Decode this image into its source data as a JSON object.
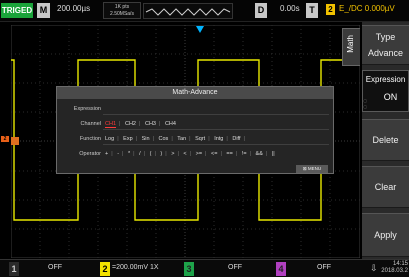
{
  "topbar": {
    "trigger_status": "TRIGED",
    "acq_mode": "M",
    "timebase": "200.00µs",
    "points_line1": "1K pts",
    "points_line2": "2.50MSa/s",
    "delay_label": "D",
    "delay_value": "0.00s",
    "trigger_label": "T",
    "trigger_channel": "2",
    "trigger_info": "E_/DC 0.000µV"
  },
  "menu": {
    "side_tab": "Math",
    "items": [
      {
        "title": "Type",
        "value": "Advance"
      },
      {
        "title": "Expression",
        "value": "ON"
      },
      {
        "title": "Delete",
        "value": ""
      },
      {
        "title": "Clear",
        "value": ""
      },
      {
        "title": "Apply",
        "value": ""
      }
    ]
  },
  "dialog": {
    "title": "Math-Advance",
    "expression_label": "Expression",
    "channel_label": "Channel",
    "channels": [
      "CH1",
      "CH2",
      "CH3",
      "CH4"
    ],
    "function_label": "Function",
    "functions": [
      "Log",
      "Exp",
      "Sin",
      "Cos",
      "Tan",
      "Sqrt",
      "Intg",
      "Diff"
    ],
    "operator_label": "Operator",
    "operators": [
      "+",
      "-",
      "*",
      "/",
      "(",
      ")",
      ">",
      "<",
      ">=",
      "<=",
      "==",
      "!=",
      "&&",
      "||"
    ],
    "menu_button": "MENU"
  },
  "bottombar": {
    "channels": [
      {
        "num": "1",
        "value": "OFF",
        "color": "#f2e100"
      },
      {
        "num": "2",
        "value": "=200.00mV 1X",
        "color": "#f2e100"
      },
      {
        "num": "3",
        "value": "OFF",
        "color": "#1ea34a"
      },
      {
        "num": "4",
        "value": "OFF",
        "color": "#b040c0"
      }
    ],
    "time": "14:15",
    "date": "2018.03.2"
  },
  "colors": {
    "trace": "#e8e800",
    "accent_red": "#ff3b3b",
    "trigger_marker": "#00b4ff"
  }
}
